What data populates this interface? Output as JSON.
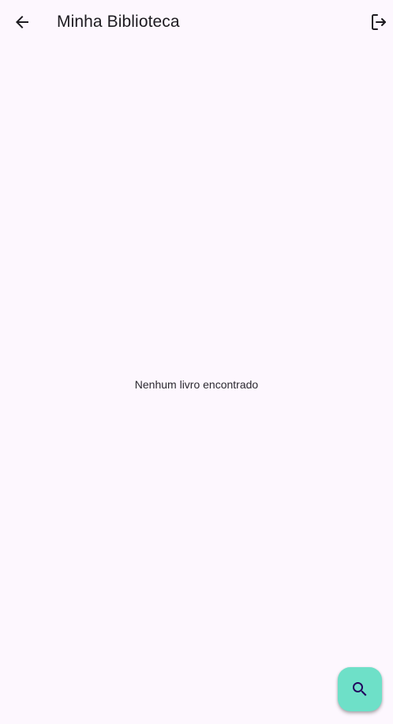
{
  "app_bar": {
    "title": "Minha Biblioteca",
    "back_icon": "arrow-back-icon",
    "logout_icon": "logout-icon"
  },
  "main": {
    "empty_message": "Nenhum livro encontrado"
  },
  "fab": {
    "icon": "search-icon",
    "color": "#6ee0c8"
  },
  "colors": {
    "background": "#fdf7fe",
    "text": "#1d1b20",
    "fab_icon": "#21005d"
  }
}
